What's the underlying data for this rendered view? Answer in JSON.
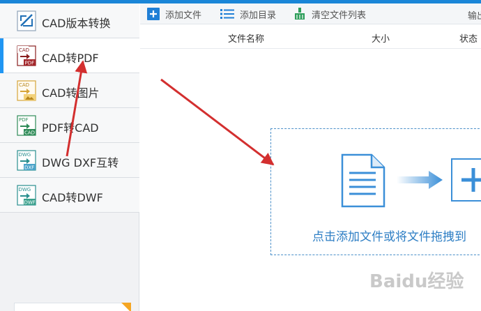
{
  "sidebar": {
    "items": [
      {
        "label": "CAD版本转换",
        "icon": "cad-version-icon",
        "active": false
      },
      {
        "label": "CAD转PDF",
        "icon": "cad-to-pdf-icon",
        "active": true
      },
      {
        "label": "CAD转图片",
        "icon": "cad-to-image-icon",
        "active": false
      },
      {
        "label": "PDF转CAD",
        "icon": "pdf-to-cad-icon",
        "active": false
      },
      {
        "label": "DWG DXF互转",
        "icon": "dwg-dxf-icon",
        "active": false
      },
      {
        "label": "CAD转DWF",
        "icon": "cad-to-dwf-icon",
        "active": false
      }
    ],
    "icon_tags": {
      "cad": "CAD",
      "pdf": "PDF",
      "dwg": "DWG",
      "dxf": "DXF",
      "dwf": "DWF"
    }
  },
  "toolbar": {
    "add_file_label": "添加文件",
    "add_folder_label": "添加目录",
    "clear_list_label": "清空文件列表",
    "output_label": "输出"
  },
  "table": {
    "headers": [
      "文件名称",
      "大小",
      "状态"
    ]
  },
  "dropzone": {
    "text": "点击添加文件或将文件拖拽到"
  },
  "watermark": "Baidu经验",
  "colors": {
    "accent": "#2196f3",
    "annotation": "#d32f2f",
    "dropzone_text": "#2d7ec4"
  }
}
